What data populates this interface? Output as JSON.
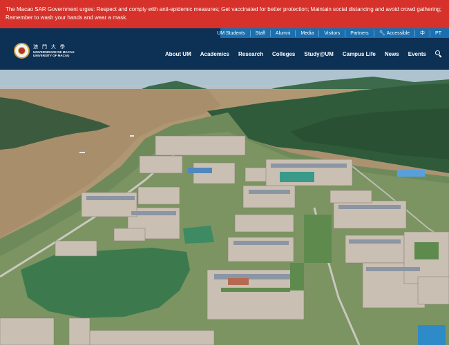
{
  "alert": {
    "text": "The Macao SAR Government urges: Respect and comply with anti-epidemic measures; Get vaccinated for better protection; Maintain social distancing and avoid crowd gathering; Remember to wash your hands and wear a mask."
  },
  "utility": {
    "items": [
      "UM Students",
      "Staff",
      "Alumni",
      "Media",
      "Visitors",
      "Partners"
    ],
    "accessible": "Accessible",
    "lang_cn": "中",
    "lang_pt": "PT"
  },
  "logo": {
    "chinese": "澳 門 大 學",
    "english_line1": "UNIVERSIDADE DE MACAU",
    "english_line2": "UNIVERSITY OF MACAU"
  },
  "nav": {
    "items": [
      "About UM",
      "Academics",
      "Research",
      "Colleges",
      "Study@UM",
      "Campus Life",
      "News",
      "Events"
    ]
  },
  "colors": {
    "alert_bg": "#d6312a",
    "navy": "#0d3055",
    "utility_bg": "#1a6fb0"
  },
  "hero": {
    "description_icon": "campus-aerial-photo"
  }
}
